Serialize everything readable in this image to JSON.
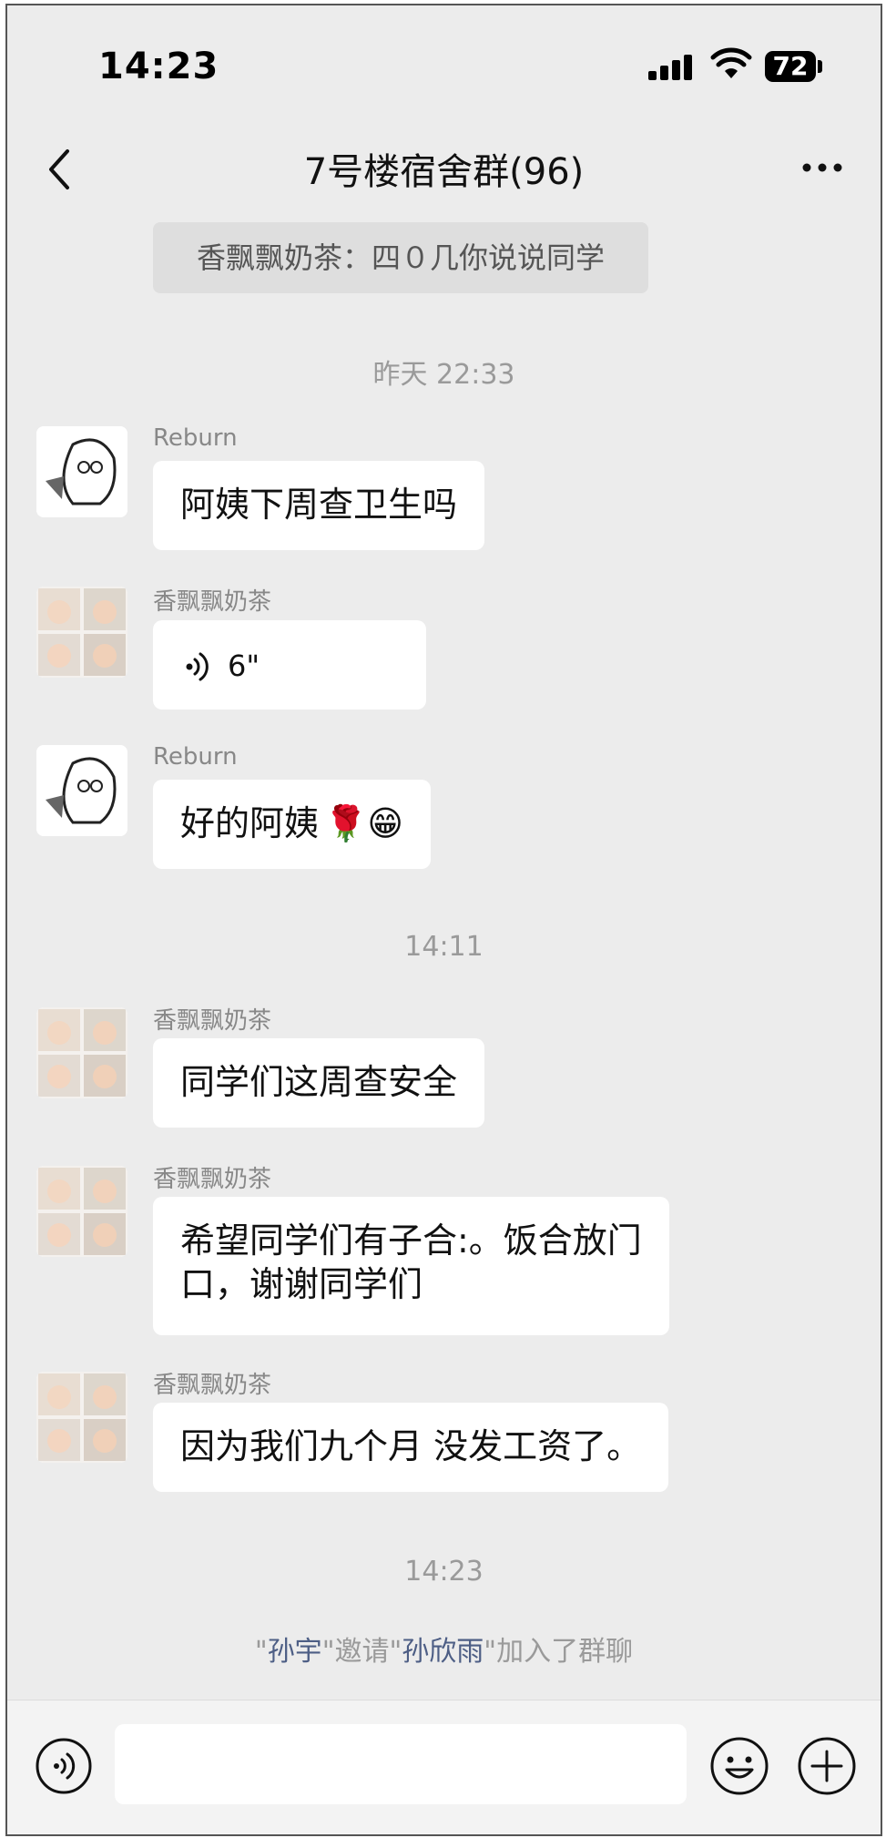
{
  "status_bar": {
    "time": "14:23",
    "battery": "72"
  },
  "header": {
    "title": "7号楼宿舍群(96)"
  },
  "pinned_banner": {
    "text": "香飘飘奶茶：四０几你说说同学"
  },
  "messages": [
    {
      "type": "timestamp",
      "text": "昨天 22:33"
    },
    {
      "type": "message",
      "sender": "Reburn",
      "text": "阿姨下周查卫生吗"
    },
    {
      "type": "voice",
      "sender": "香飘飘奶茶",
      "duration": "6\""
    },
    {
      "type": "message",
      "sender": "Reburn",
      "text": "好的阿姨",
      "emoji": "🌹😁"
    },
    {
      "type": "timestamp",
      "text": "14:11"
    },
    {
      "type": "message",
      "sender": "香飘飘奶茶",
      "text": "同学们这周查安全"
    },
    {
      "type": "message",
      "sender": "香飘飘奶茶",
      "line1": "希望同学们有子合:。饭合放门",
      "line2": "口，谢谢同学们"
    },
    {
      "type": "message",
      "sender": "香飘飘奶茶",
      "text": "因为我们九个月 没发工资了。"
    },
    {
      "type": "timestamp",
      "text": "14:23"
    },
    {
      "type": "system",
      "quote_open": "\"",
      "inviter": "孙宇",
      "middle": "\"邀请\"",
      "invitee": "孙欣雨",
      "end": "\"加入了群聊"
    }
  ],
  "icons": {
    "back": "chevron-left-icon",
    "more": "more-dots-icon",
    "voice_input": "voice-icon",
    "emoji": "emoji-icon",
    "plus": "plus-icon"
  },
  "colors": {
    "chat_bg": "#ececec",
    "bubble": "#ffffff",
    "name_link": "#4d5e85"
  }
}
